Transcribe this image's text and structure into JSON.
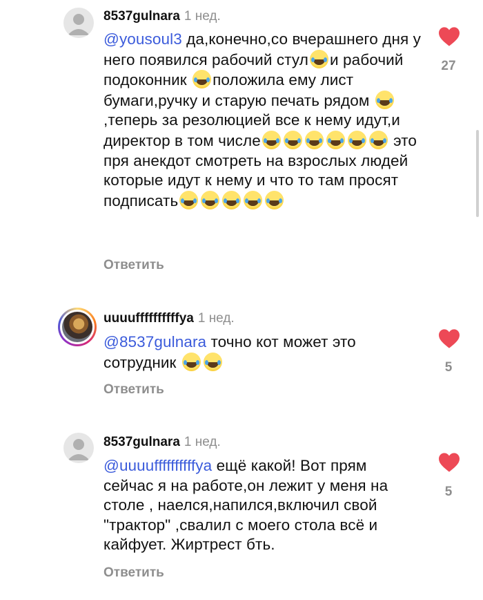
{
  "comments": [
    {
      "username": "8537gulnara",
      "time": "1 нед.",
      "mention": "@yousoul3",
      "segments": {
        "s1": " да,конечно,со вчерашнего дня у него появился рабочий стул",
        "s2": "и рабочий подоконник ",
        "s3": "положила ему лист бумаги,ручку и старую печать рядом ",
        "s4": ",теперь за резолюцией все к нему идут,и директор в том числе",
        "s5": " это пря анекдот смотреть на взрослых людей которые идут к нему и что то там просят подписать"
      },
      "likes": "27",
      "reply_label": "Ответить"
    },
    {
      "username": "uuuuffffffffffya",
      "time": "1 нед.",
      "mention": "@8537gulnara",
      "segments": {
        "s1": " точно кот может это сотрудник "
      },
      "likes": "5",
      "reply_label": "Ответить"
    },
    {
      "username": "8537gulnara",
      "time": "1 нед.",
      "mention": "@uuuuffffffffffya",
      "segments": {
        "s1": " ещё какой! Вот прям сейчас я на работе,он лежит у меня на столе , наелся,напился,включил свой \"трактор\" ,свалил с моего стола всё и кайфует. Жиртрест бть."
      },
      "likes": "5",
      "reply_label": "Ответить"
    }
  ],
  "icons": {
    "emoji": "face-with-tears-of-joy-icon",
    "like": "heart-filled-icon",
    "avatar": "default-avatar-icon"
  },
  "colors": {
    "mention": "#3b5bdb",
    "heart": "#ed4956",
    "muted": "#8e8e8e"
  }
}
